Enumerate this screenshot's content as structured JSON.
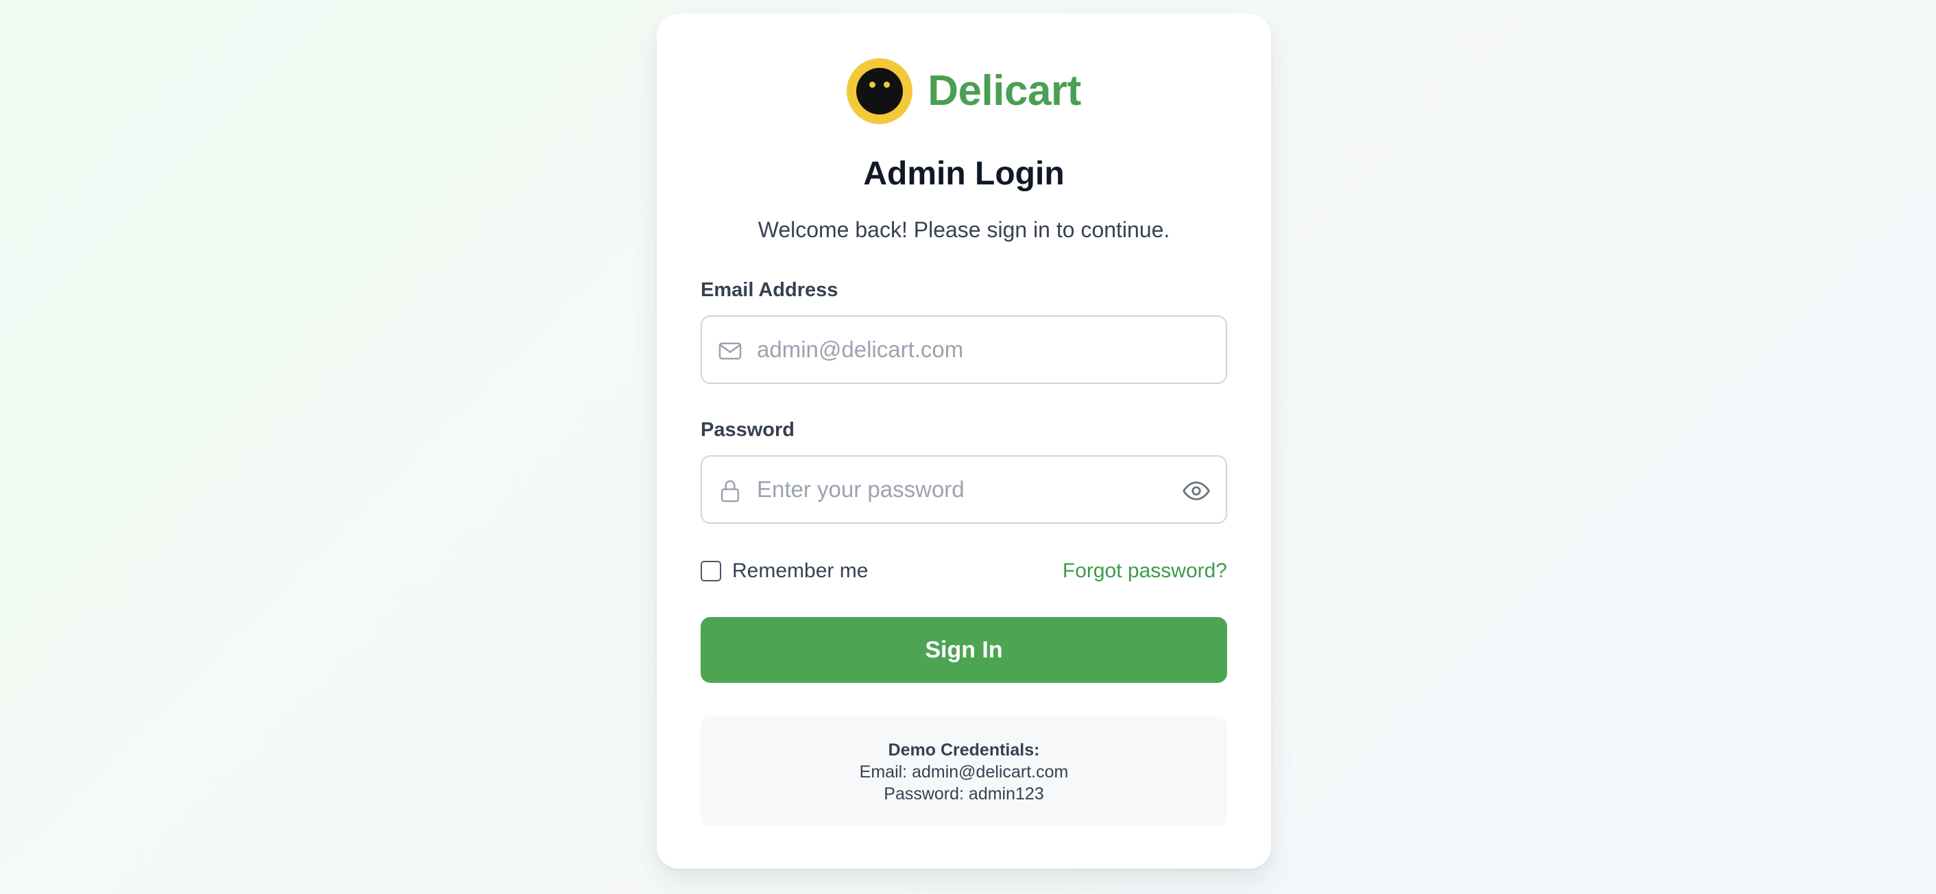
{
  "brand": {
    "name": "Delicart",
    "logo_icon": "smiley-face-icon",
    "brand_color": "#4a9f52",
    "logo_color": "#f3c83a"
  },
  "login": {
    "title": "Admin Login",
    "subtitle": "Welcome back! Please sign in to continue."
  },
  "email": {
    "label": "Email Address",
    "placeholder": "admin@delicart.com",
    "value": "",
    "icon": "mail-icon"
  },
  "password": {
    "label": "Password",
    "placeholder": "Enter your password",
    "value": "",
    "icon": "lock-icon",
    "toggle_icon": "eye-icon"
  },
  "remember": {
    "label": "Remember me",
    "checked": false
  },
  "forgot": {
    "label": "Forgot password?"
  },
  "signin": {
    "label": "Sign In",
    "color": "#4da453"
  },
  "demo": {
    "title": "Demo Credentials:",
    "email_line": "Email: admin@delicart.com",
    "password_line": "Password: admin123"
  }
}
